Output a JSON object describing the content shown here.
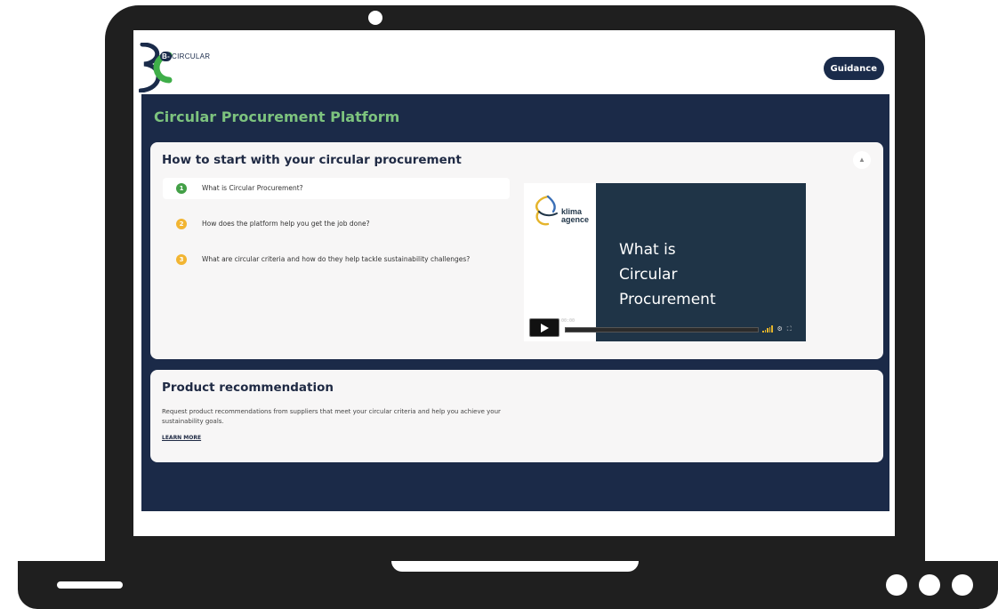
{
  "header": {
    "logo_lead": "B-",
    "logo_rest": "CIRCULAR",
    "guidance_label": "Guidance"
  },
  "platform": {
    "title": "Circular Procurement Platform"
  },
  "start_section": {
    "title": "How to start with your circular procurement",
    "collapse_icon": "chevron-up-icon",
    "items": [
      {
        "number": "1",
        "text": "What is Circular Procurement?",
        "color": "#43a047"
      },
      {
        "number": "2",
        "text": "How does the platform help you get the job done?",
        "color": "#f2b532"
      },
      {
        "number": "3",
        "text": "What are circular criteria and how do they help tackle sustainability challenges?",
        "color": "#f2b532"
      }
    ]
  },
  "video": {
    "logo_line1": "klima",
    "logo_line2": "agence",
    "headline_line1": "What is",
    "headline_line2": "Circular",
    "headline_line3": "Procurement",
    "time": "00:00",
    "play_icon": "play-icon",
    "settings_icon": "gear-icon",
    "fullscreen_icon": "fullscreen-icon"
  },
  "product_section": {
    "title": "Product recommendation",
    "description": "Request product recommendations from suppliers that meet your circular criteria and help you achieve your sustainability goals.",
    "learn_more": "LEARN MORE"
  },
  "colors": {
    "navy": "#1b2a48",
    "brand_green": "#7dc37e",
    "accent_yellow": "#f2b532"
  }
}
